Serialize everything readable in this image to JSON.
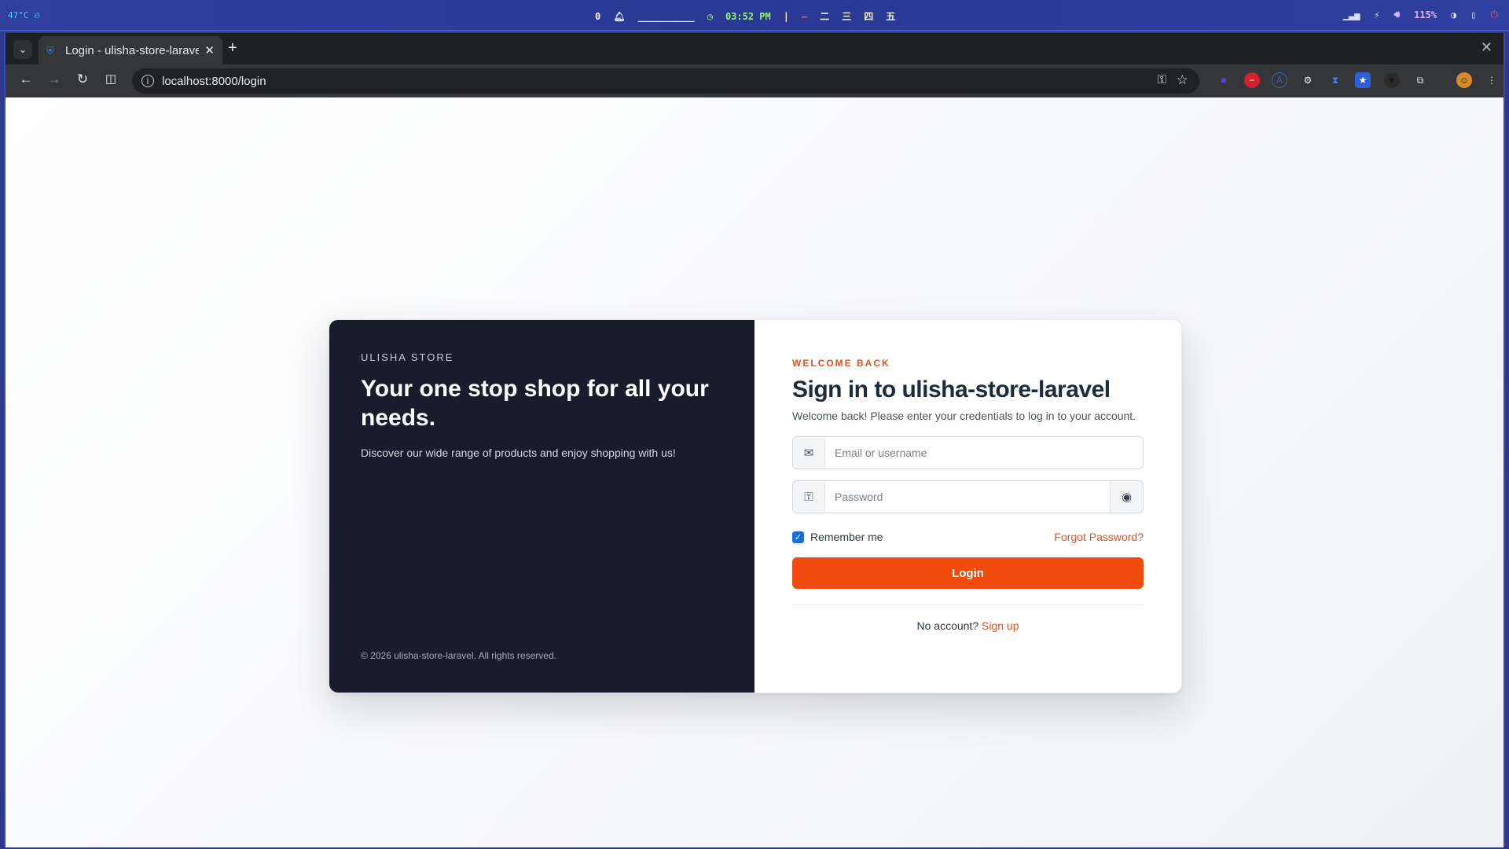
{
  "system_bar": {
    "temperature": "47°C",
    "notifications": "0",
    "clock": "03:52 PM",
    "battery_volume": "115%",
    "workspace_glyphs": [
      "二",
      "三",
      "四",
      "五"
    ]
  },
  "browser": {
    "tab": {
      "title": "Login - ulisha-store-laravel"
    },
    "url": "localhost:8000/login"
  },
  "left_panel": {
    "brand": "ULISHA STORE",
    "hero": "Your one stop shop for all your needs.",
    "description": "Discover our wide range of products and enjoy shopping with us!",
    "copyright": "© 2026 ulisha-store-laravel. All rights reserved."
  },
  "form": {
    "kicker": "WELCOME BACK",
    "heading": "Sign in to ulisha-store-laravel",
    "subtitle": "Welcome back! Please enter your credentials to log in to your account.",
    "email_placeholder": "Email or username",
    "password_placeholder": "Password",
    "remember_label": "Remember me",
    "remember_checked": true,
    "forgot_label": "Forgot Password?",
    "login_label": "Login",
    "no_account_text": "No account?",
    "signup_label": "Sign up"
  },
  "colors": {
    "accent": "#f24b0e",
    "left_panel_bg": "#181c2c",
    "checkbox": "#1a6fe0"
  }
}
